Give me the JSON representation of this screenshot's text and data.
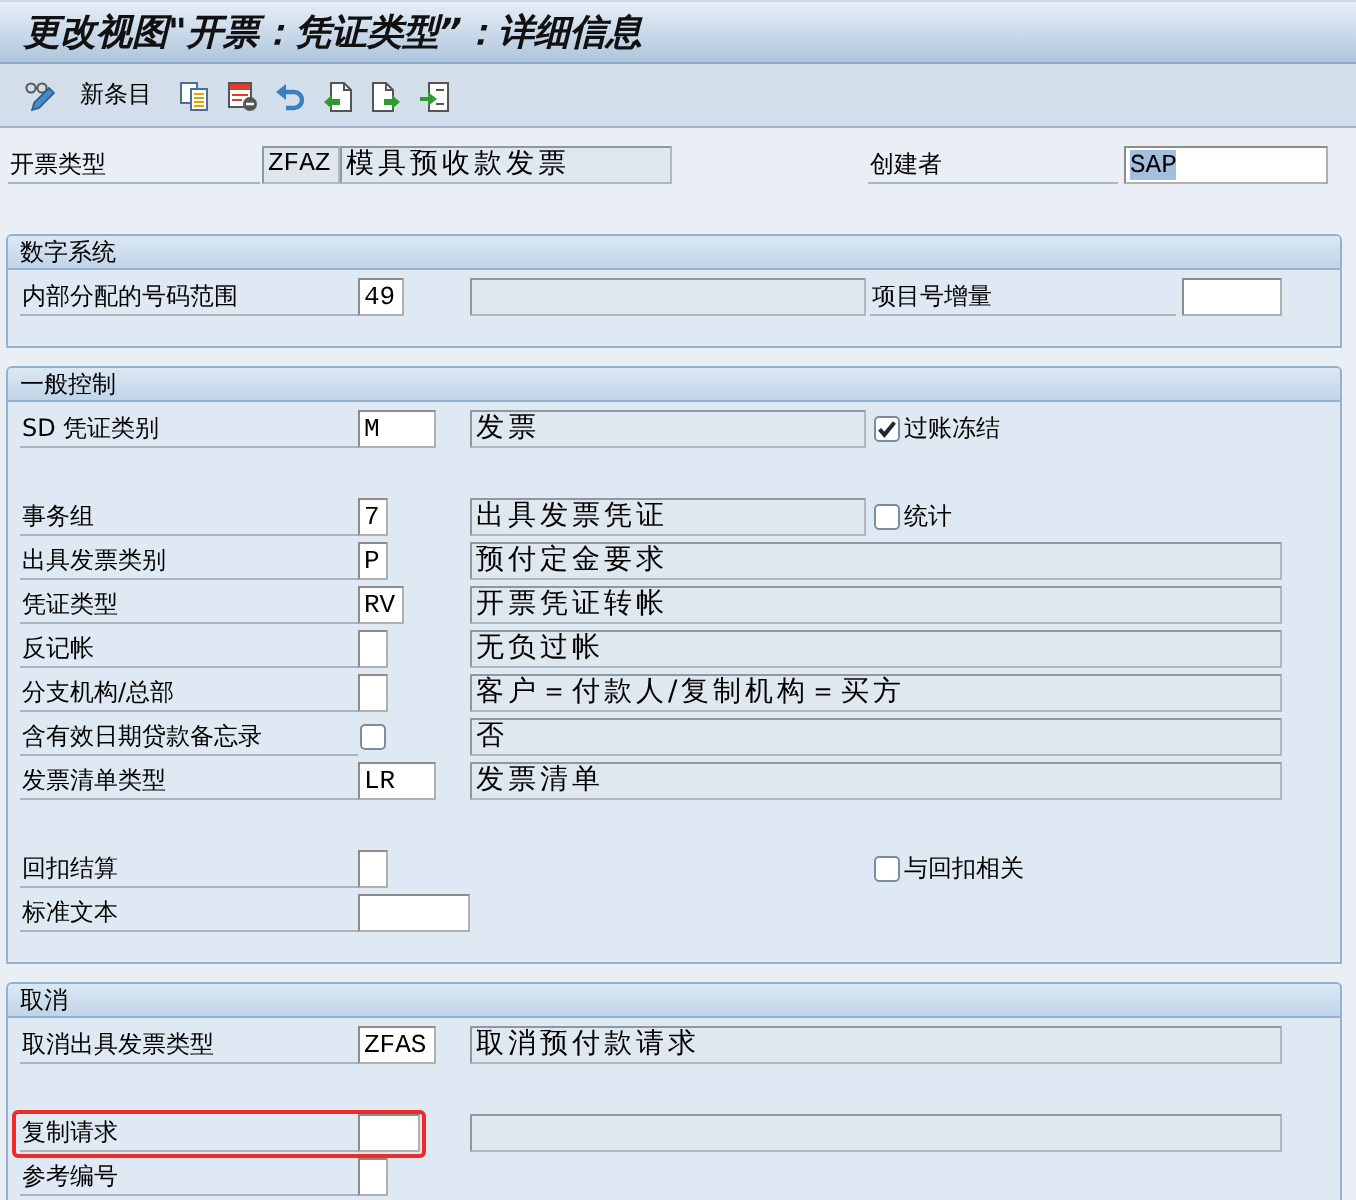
{
  "window": {
    "title": "更改视图\"开票：凭证类型”：详细信息"
  },
  "toolbar": {
    "new_entries": "新条目"
  },
  "header": {
    "label": "开票类型",
    "value": "ZFAZ",
    "description": "模具预收款发票",
    "creator": {
      "label": "创建者",
      "value": "SAP",
      "text_selected": true
    }
  },
  "sections": [
    {
      "title": "数字系统",
      "rows": [
        {
          "kind": "field",
          "label": "内部分配的号码范围",
          "value": "49",
          "highlighted": false,
          "right_field": {
            "label": "项目号增量"
          }
        }
      ]
    },
    {
      "title": "一般控制",
      "rows": [
        {
          "kind": "field",
          "label": "SD 凭证类别",
          "value": "M",
          "description": "发票",
          "highlighted": false,
          "checkbox": {
            "label": "过账冻结",
            "checked": true
          }
        },
        {
          "kind": "field",
          "label": "事务组",
          "value": "7",
          "description": "出具发票凭证",
          "highlighted": false,
          "checkbox": {
            "label": "统计",
            "checked": false
          }
        },
        {
          "kind": "field",
          "label": "出具发票类别",
          "value": "P",
          "description": "预付定金要求",
          "highlighted": false
        },
        {
          "kind": "field",
          "label": "凭证类型",
          "value": "RV",
          "description": "开票凭证转帐",
          "highlighted": false
        },
        {
          "kind": "field",
          "label": "反记帐",
          "description": "无负过帐",
          "highlighted": false
        },
        {
          "kind": "field",
          "label": "分支机构/总部",
          "description": "客户＝付款人/复制机构＝买方",
          "highlighted": false
        },
        {
          "kind": "checkbox",
          "label": "含有效日期贷款备忘录",
          "checked": false,
          "description": "否",
          "highlighted": false
        },
        {
          "kind": "field",
          "label": "发票清单类型",
          "value": "LR",
          "description": "发票清单",
          "highlighted": false
        },
        {
          "kind": "field",
          "label": "回扣结算",
          "highlighted": false,
          "checkbox": {
            "label": "与回扣相关",
            "checked": false
          }
        },
        {
          "kind": "field",
          "label": "标准文本",
          "highlighted": false
        }
      ]
    },
    {
      "title": "取消",
      "rows": [
        {
          "kind": "field",
          "label": "取消出具发票类型",
          "value": "ZFAS",
          "description": "取消预付款请求",
          "highlighted": false
        },
        {
          "kind": "field",
          "label": "复制请求",
          "highlighted": true
        },
        {
          "kind": "field",
          "label": "参考编号",
          "highlighted": false
        }
      ]
    }
  ]
}
